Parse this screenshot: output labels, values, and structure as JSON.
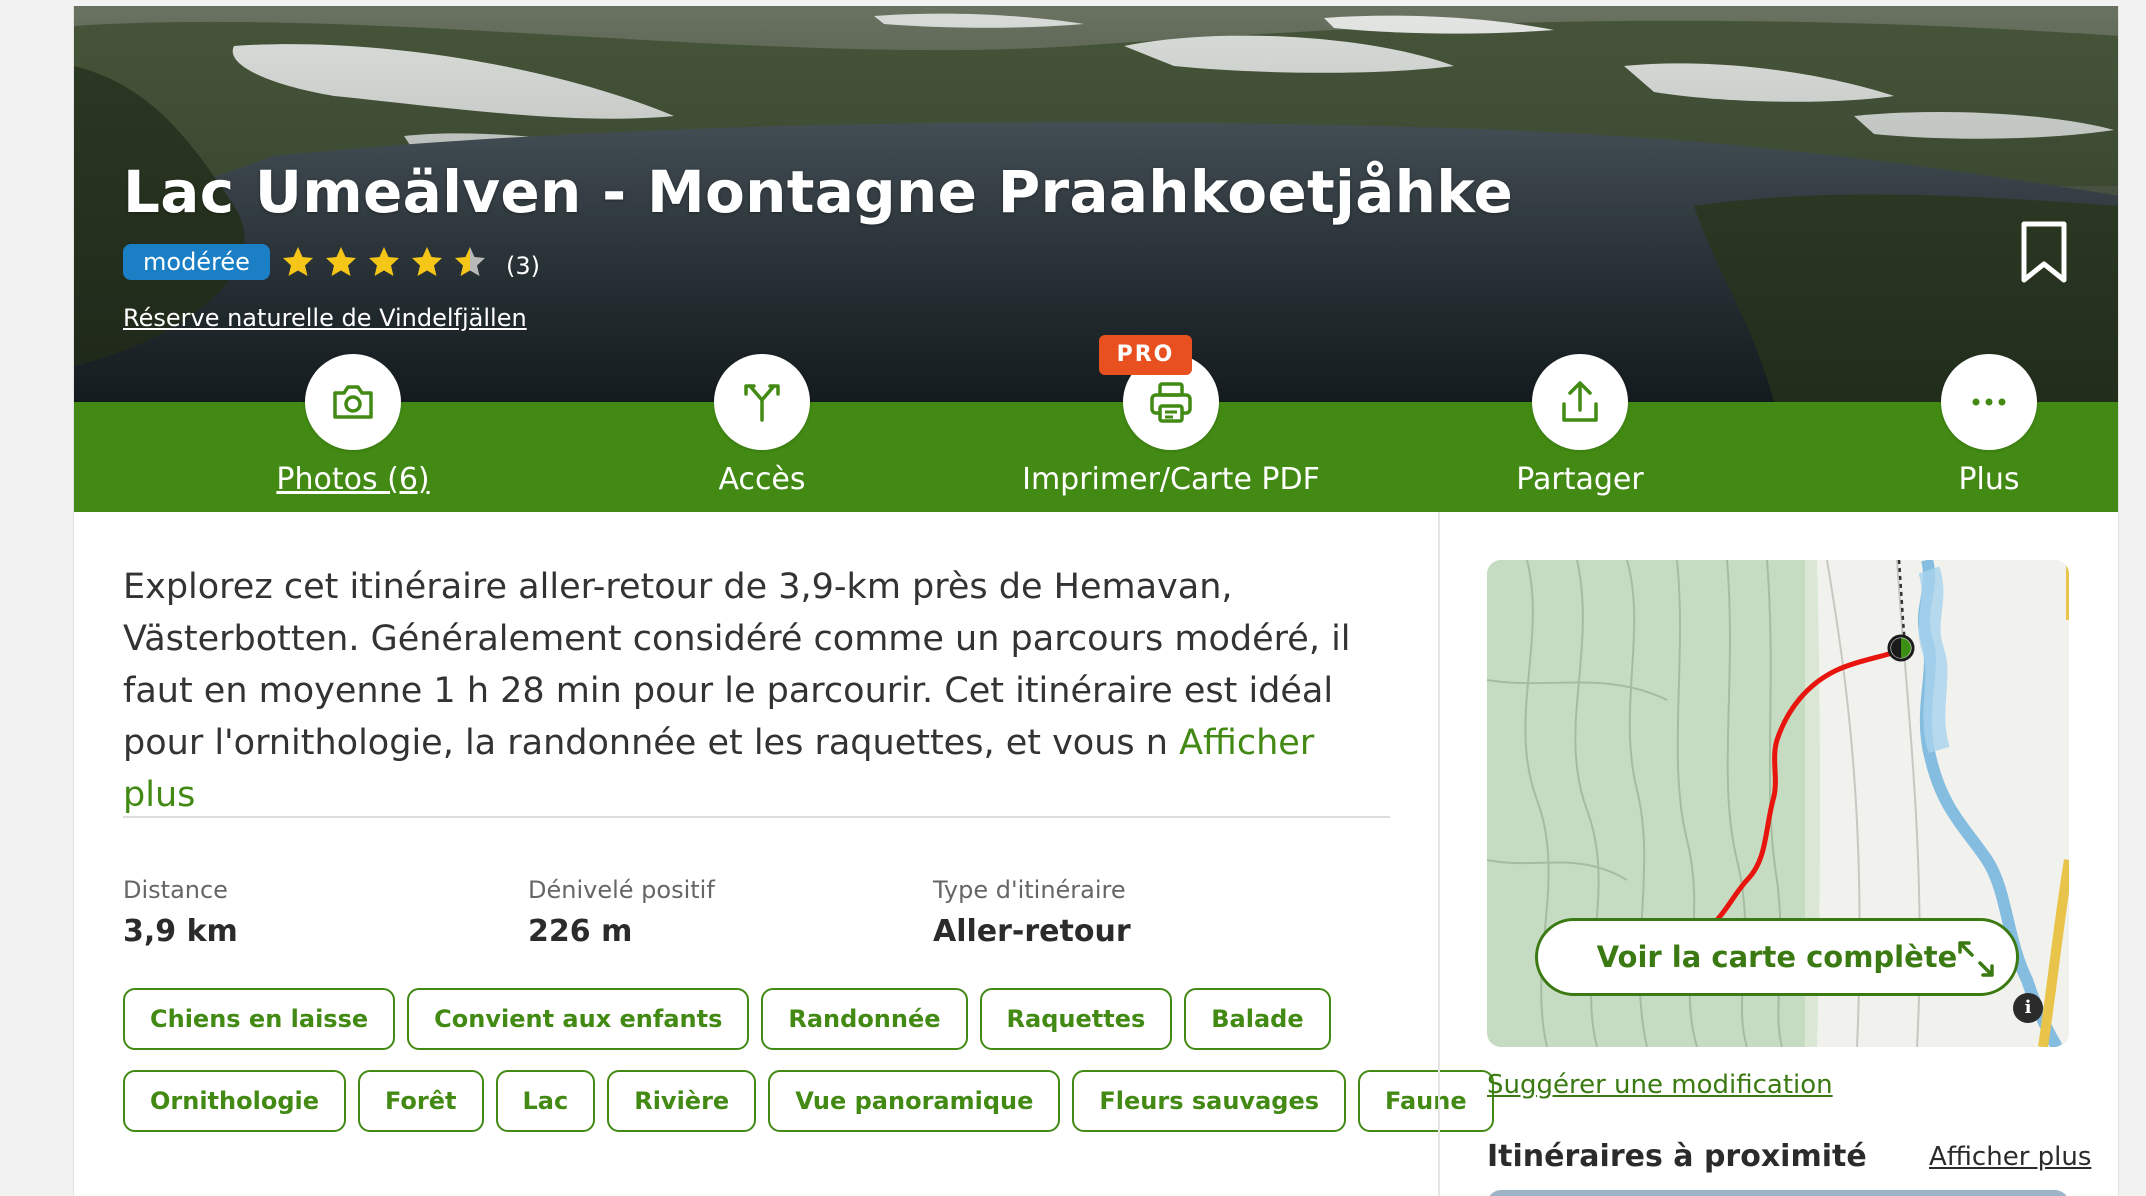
{
  "trail": {
    "title": "Lac Umeälven - Montagne Praahkoetjåhke",
    "difficulty": "modérée",
    "rating": 4.5,
    "rating_count": "(3)",
    "area": "Réserve naturelle de Vindelfjällen"
  },
  "actions": [
    {
      "label": "Photos (6)",
      "icon": "camera-icon"
    },
    {
      "label": "Accès",
      "icon": "directions-icon"
    },
    {
      "label": "Imprimer/Carte PDF",
      "icon": "printer-icon",
      "badge": "PRO"
    },
    {
      "label": "Partager",
      "icon": "share-icon"
    },
    {
      "label": "Plus",
      "icon": "more-icon"
    }
  ],
  "description": {
    "text": "Explorez cet itinéraire aller-retour de 3,9-km près de Hemavan, Västerbotten. Généralement considéré comme un parcours modéré, il faut en moyenne 1 h 28 min pour le parcourir. Cet itinéraire est idéal pour l'ornithologie, la randonnée et les raquettes, et vous n",
    "more": "Afficher plus"
  },
  "stats": [
    {
      "label": "Distance",
      "value": "3,9 km"
    },
    {
      "label": "Dénivelé positif",
      "value": "226 m"
    },
    {
      "label": "Type d'itinéraire",
      "value": "Aller-retour"
    }
  ],
  "tags_row1": [
    "Chiens en laisse",
    "Convient aux enfants",
    "Randonnée",
    "Raquettes",
    "Balade"
  ],
  "tags_row2": [
    "Ornithologie",
    "Forêt",
    "Lac",
    "Rivière",
    "Vue panoramique",
    "Fleurs sauvages",
    "Faune"
  ],
  "map": {
    "button": "Voir la carte complète",
    "info": "i",
    "route_color": "#e8140e"
  },
  "sidebar": {
    "suggest": "Suggérer une modification",
    "nearby_title": "Itinéraires à proximité",
    "nearby_more": "Afficher plus"
  },
  "colors": {
    "brand_green": "#428a13",
    "difficulty_blue": "#1b7fc6",
    "pro_orange": "#e8511f",
    "star_yellow": "#f5c518"
  }
}
